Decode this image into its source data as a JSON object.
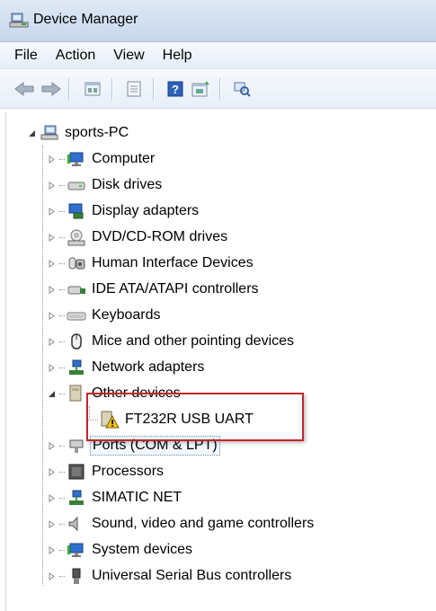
{
  "window": {
    "title": "Device Manager"
  },
  "menu": [
    "File",
    "Action",
    "View",
    "Help"
  ],
  "toolbar": {
    "buttons": [
      "back-arrow-icon",
      "forward-arrow-icon",
      "properties-icon",
      "show-hidden-icon",
      "help-icon",
      "update-driver-icon",
      "scan-hardware-icon"
    ]
  },
  "tree": {
    "root": "sports-PC",
    "items": [
      {
        "label": "Computer",
        "icon": "computer-icon"
      },
      {
        "label": "Disk drives",
        "icon": "disk-drive-icon"
      },
      {
        "label": "Display adapters",
        "icon": "display-adapter-icon"
      },
      {
        "label": "DVD/CD-ROM drives",
        "icon": "dvd-drive-icon"
      },
      {
        "label": "Human Interface Devices",
        "icon": "hid-icon"
      },
      {
        "label": "IDE ATA/ATAPI controllers",
        "icon": "ide-controller-icon"
      },
      {
        "label": "Keyboards",
        "icon": "keyboard-icon"
      },
      {
        "label": "Mice and other pointing devices",
        "icon": "mouse-icon"
      },
      {
        "label": "Network adapters",
        "icon": "network-adapter-icon"
      },
      {
        "label": "Other devices",
        "icon": "other-devices-icon"
      },
      {
        "label": "FT232R USB UART",
        "icon": "warning-device-icon"
      },
      {
        "label": "Ports (COM & LPT)",
        "icon": "port-icon"
      },
      {
        "label": "Processors",
        "icon": "processor-icon"
      },
      {
        "label": "SIMATIC NET",
        "icon": "simatic-icon"
      },
      {
        "label": "Sound, video and game controllers",
        "icon": "sound-icon"
      },
      {
        "label": "System devices",
        "icon": "system-devices-icon"
      },
      {
        "label": "Universal Serial Bus controllers",
        "icon": "usb-icon"
      }
    ]
  },
  "colors": {
    "highlight_border": "#c3252c",
    "warning": "#f2c318"
  }
}
